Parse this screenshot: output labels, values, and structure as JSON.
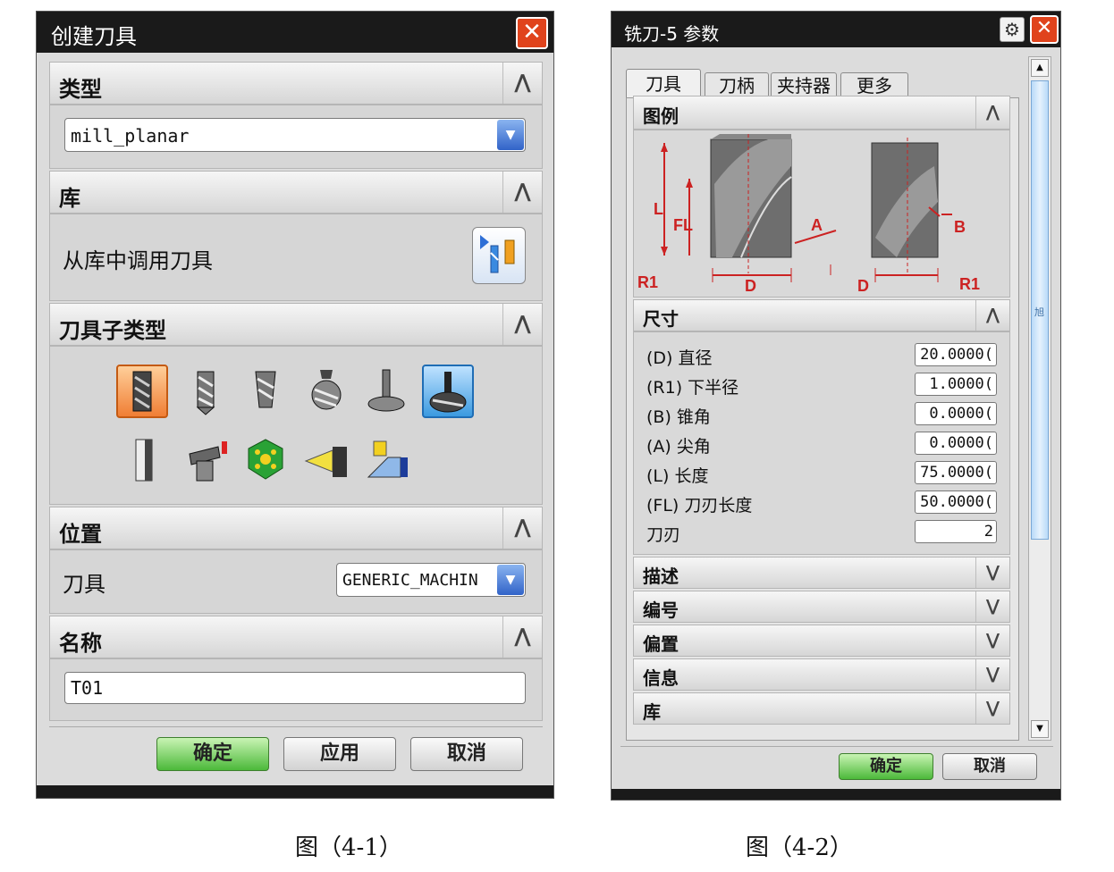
{
  "dialog1": {
    "title": "创建刀具",
    "sections": {
      "type": {
        "label": "类型",
        "combo_value": "mill_planar"
      },
      "library": {
        "label": "库",
        "call_label": "从库中调用刀具"
      },
      "subtype": {
        "label": "刀具子类型"
      },
      "location": {
        "label": "位置",
        "tool_label": "刀具",
        "tool_value": "GENERIC_MACHIN"
      },
      "name": {
        "label": "名称",
        "name_value": "T01"
      }
    },
    "buttons": {
      "ok": "确定",
      "apply": "应用",
      "cancel": "取消"
    }
  },
  "dialog2": {
    "title": "铣刀-5 参数",
    "tabs": [
      "刀具",
      "刀柄",
      "夹持器",
      "更多"
    ],
    "legend": {
      "label": "图例"
    },
    "legend_labels": {
      "L": "L",
      "FL": "FL",
      "A": "A",
      "R1_left": "R1",
      "D_left": "D",
      "B": "B",
      "D_right": "D",
      "R1_right": "R1"
    },
    "dimensions": {
      "label": "尺寸",
      "rows": [
        {
          "label": "(D) 直径",
          "value": "20.0000("
        },
        {
          "label": "(R1) 下半径",
          "value": "1.0000("
        },
        {
          "label": "(B) 锥角",
          "value": "0.0000("
        },
        {
          "label": "(A) 尖角",
          "value": "0.0000("
        },
        {
          "label": "(L) 长度",
          "value": "75.0000("
        },
        {
          "label": "(FL) 刀刃长度",
          "value": "50.0000("
        },
        {
          "label": "刀刃",
          "value": "2"
        }
      ]
    },
    "collapsed_sections": [
      "描述",
      "编号",
      "偏置",
      "信息",
      "库"
    ],
    "scrollbar_label": "旭",
    "buttons": {
      "ok": "确定",
      "cancel": "取消"
    }
  },
  "captions": {
    "fig1": "图（4-1）",
    "fig2": "图（4-2）"
  },
  "colors": {
    "titlebar": "#1a1a1a",
    "close": "#e0431c",
    "ok_green": "#4cb93a",
    "selected_orange": "#f07e34",
    "selected_blue": "#3b9ae0",
    "dimension_red": "#cc2222"
  }
}
